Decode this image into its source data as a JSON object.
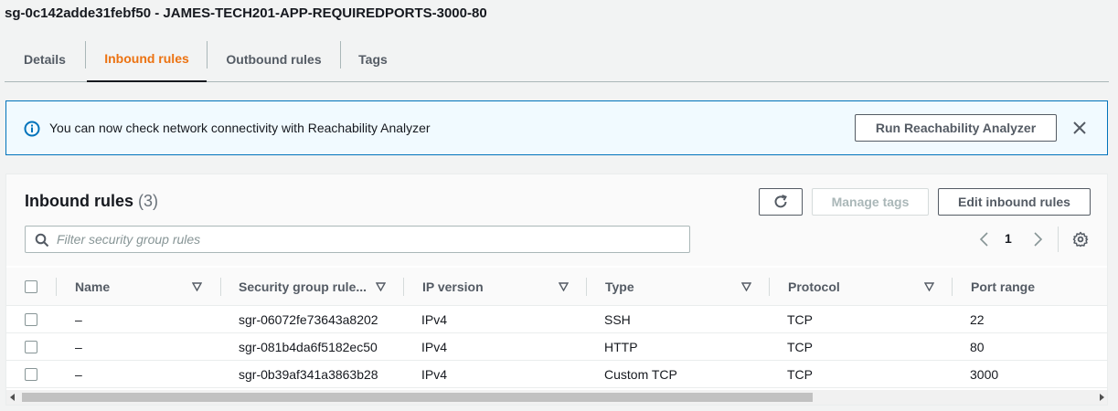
{
  "security_group": {
    "title": "sg-0c142adde31febf50 - JAMES-TECH201-APP-REQUIREDPORTS-3000-80"
  },
  "tabs": [
    {
      "label": "Details",
      "active": false
    },
    {
      "label": "Inbound rules",
      "active": true
    },
    {
      "label": "Outbound rules",
      "active": false
    },
    {
      "label": "Tags",
      "active": false
    }
  ],
  "alert": {
    "icon": "info-icon",
    "message": "You can now check network connectivity with Reachability Analyzer",
    "button_label": "Run Reachability Analyzer",
    "close_icon": "close-icon"
  },
  "panel": {
    "title": "Inbound rules",
    "count": "(3)",
    "refresh_icon": "refresh-icon",
    "manage_tags_label": "Manage tags",
    "edit_label": "Edit inbound rules",
    "filter_placeholder": "Filter security group rules",
    "filter_value": "",
    "current_page": "1"
  },
  "table": {
    "columns": [
      "Name",
      "Security group rule...",
      "IP version",
      "Type",
      "Protocol",
      "Port range"
    ],
    "rows": [
      {
        "name": "–",
        "rule_id": "sgr-06072fe73643a8202",
        "ip_version": "IPv4",
        "type": "SSH",
        "protocol": "TCP",
        "port_range": "22"
      },
      {
        "name": "–",
        "rule_id": "sgr-081b4da6f5182ec50",
        "ip_version": "IPv4",
        "type": "HTTP",
        "protocol": "TCP",
        "port_range": "80"
      },
      {
        "name": "–",
        "rule_id": "sgr-0b39af341a3863b28",
        "ip_version": "IPv4",
        "type": "Custom TCP",
        "protocol": "TCP",
        "port_range": "3000"
      }
    ]
  },
  "colors": {
    "accent_orange": "#ec7211",
    "info_blue": "#0073bb",
    "alert_bg": "#f1faff",
    "text_dark": "#16191f",
    "text_muted": "#545b64"
  }
}
